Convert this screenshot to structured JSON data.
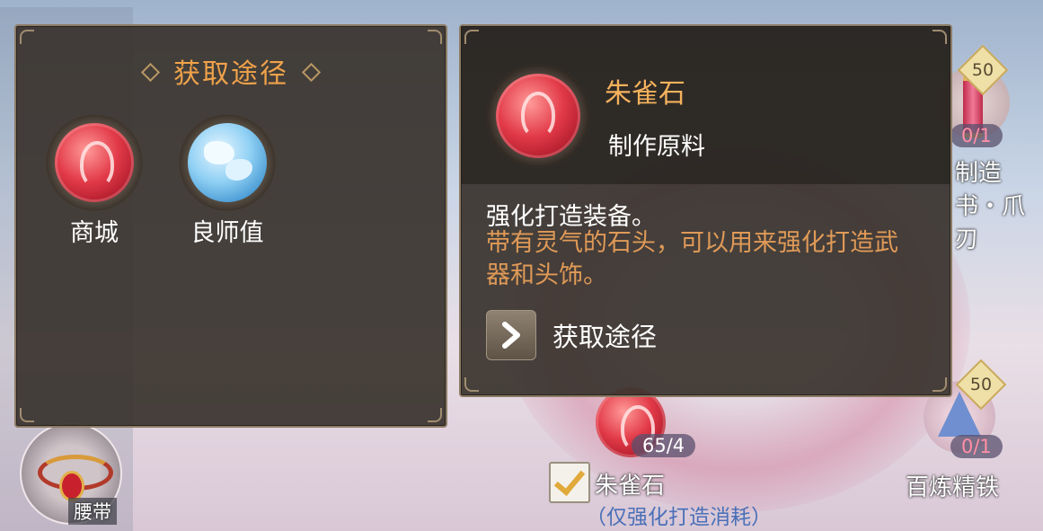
{
  "left_panel": {
    "title": "获取途径",
    "sources": [
      {
        "label": "商城",
        "icon": "zhuque-stone-icon"
      },
      {
        "label": "良师值",
        "icon": "mentor-points-icon"
      }
    ]
  },
  "right_panel": {
    "item_name": "朱雀石",
    "item_type": "制作原料",
    "desc_line1": "强化打造装备。",
    "desc_line2": "带有灵气的石头，可以用来强化打造武器和头饰。",
    "goto_label": "获取途径"
  },
  "background": {
    "belt_label": "腰带",
    "scroll_badge": "50",
    "scroll_count": "0/1",
    "scroll_label": "制造书・爪刃",
    "stone_count": "65/4",
    "stone_label": "朱雀石",
    "stone_note": "（仅强化打造消耗）",
    "iron_badge": "50",
    "iron_count": "0/1",
    "iron_label": "百炼精铁"
  },
  "colors": {
    "title_orange": "#f0a24a",
    "name_gold": "#f5b25c",
    "desc_orange": "#e09a57",
    "panel_bg": "#3a342e"
  }
}
